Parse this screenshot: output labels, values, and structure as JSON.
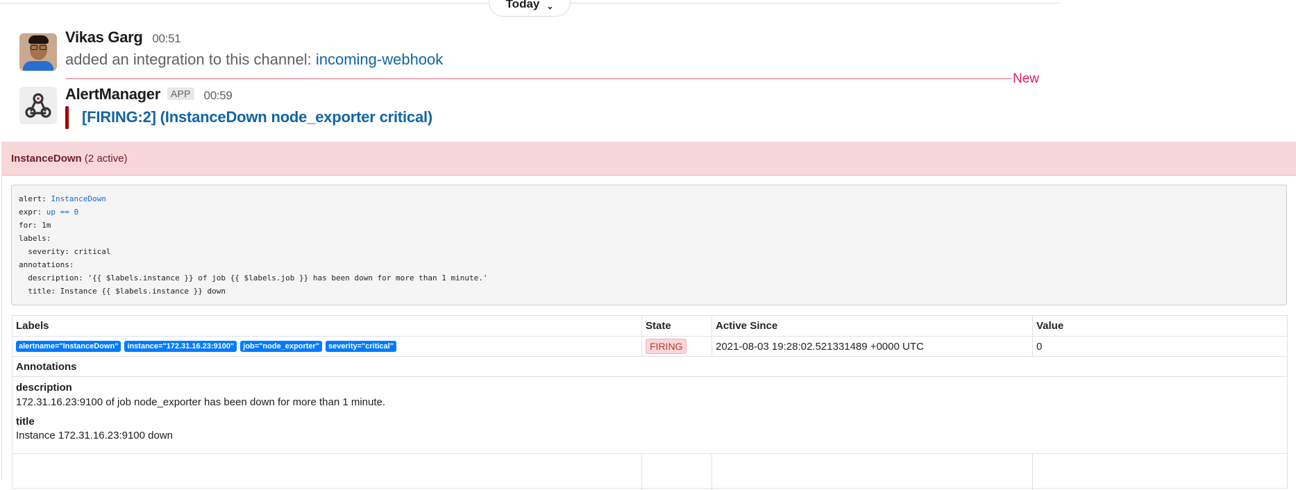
{
  "day_divider": {
    "label": "Today"
  },
  "messages": [
    {
      "user": "Vikas Garg",
      "time": "00:51",
      "text": "added an integration to this channel:",
      "link": "incoming-webhook"
    },
    {
      "user": "AlertManager",
      "badge": "APP",
      "time": "00:59",
      "attachment_title": "[FIRING:2]  (InstanceDown node_exporter critical)"
    }
  ],
  "new_divider": {
    "label": "New"
  },
  "alert_panel": {
    "group_name": "InstanceDown",
    "group_count": "(2 active)",
    "rule": {
      "alert_key": "alert: ",
      "alert_val": "InstanceDown",
      "expr_key": "expr: ",
      "expr_val": "up == 0",
      "for": "for: 1m",
      "labels": "labels:",
      "severity": "  severity: critical",
      "annotations": "annotations:",
      "description": "  description: '{{ $labels.instance }} of job {{ $labels.job }} has been down for more than 1 minute.'",
      "title": "  title: Instance {{ $labels.instance }} down"
    },
    "table": {
      "headers": [
        "Labels",
        "State",
        "Active Since",
        "Value"
      ],
      "row": {
        "labels": [
          "alertname=\"InstanceDown\"",
          "instance=\"172.31.16.23:9100\"",
          "job=\"node_exporter\"",
          "severity=\"critical\""
        ],
        "state": "FIRING",
        "active_since": "2021-08-03 19:28:02.521331489 +0000 UTC",
        "value": "0"
      },
      "annotations_header": "Annotations",
      "annotations": [
        {
          "key": "description",
          "value": "172.31.16.23:9100 of job node_exporter has been down for more than 1 minute."
        },
        {
          "key": "title",
          "value": "Instance 172.31.16.23:9100 down"
        }
      ]
    }
  }
}
